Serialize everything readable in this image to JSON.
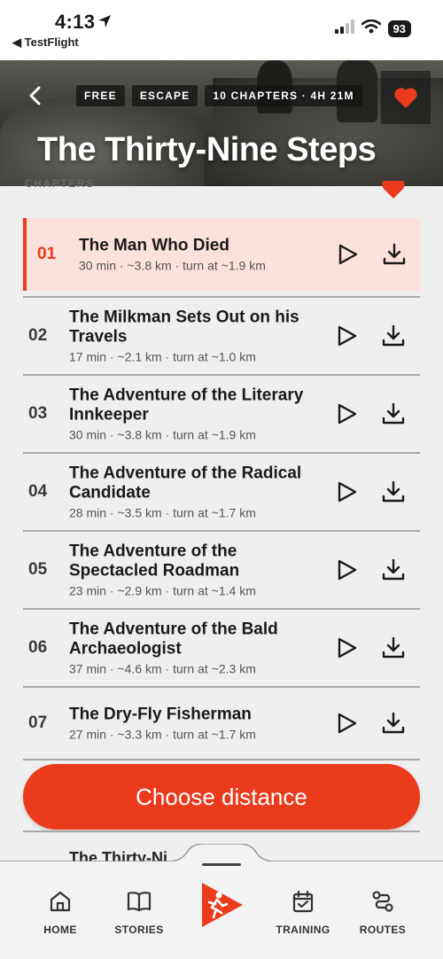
{
  "status": {
    "time": "4:13",
    "back_app": "◀ TestFlight",
    "battery": "93"
  },
  "hero": {
    "tags": [
      "FREE",
      "ESCAPE",
      "10 CHAPTERS · 4H 21M"
    ],
    "title": "The Thirty-Nine Steps"
  },
  "section_label": "CHAPTERS",
  "chapters": [
    {
      "num": "01",
      "title": "The Man Who Died",
      "meta": "30 min · ~3.8 km · turn at ~1.9 km"
    },
    {
      "num": "02",
      "title": "The Milkman Sets Out on his Travels",
      "meta": "17 min · ~2.1 km · turn at ~1.0 km"
    },
    {
      "num": "03",
      "title": "The Adventure of the Literary Innkeeper",
      "meta": "30 min · ~3.8 km · turn at ~1.9 km"
    },
    {
      "num": "04",
      "title": "The Adventure of the Radical Candidate",
      "meta": "28 min · ~3.5 km · turn at ~1.7 km"
    },
    {
      "num": "05",
      "title": "The Adventure of the Spectacled Roadman",
      "meta": "23 min · ~2.9 km · turn at ~1.4 km"
    },
    {
      "num": "06",
      "title": "The Adventure of the Bald Archaeologist",
      "meta": "37 min · ~4.6 km · turn at ~2.3 km"
    },
    {
      "num": "07",
      "title": "The Dry-Fly Fisherman",
      "meta": "27 min · ~3.3 km · turn at ~1.7 km"
    }
  ],
  "cta": "Choose distance",
  "peek_text": "The Thirty-Ni",
  "tabs": {
    "home": "HOME",
    "stories": "STORIES",
    "training": "TRAINING",
    "routes": "ROUTES"
  },
  "colors": {
    "accent": "#ec3b1c",
    "selected_row": "#fde1dc"
  }
}
